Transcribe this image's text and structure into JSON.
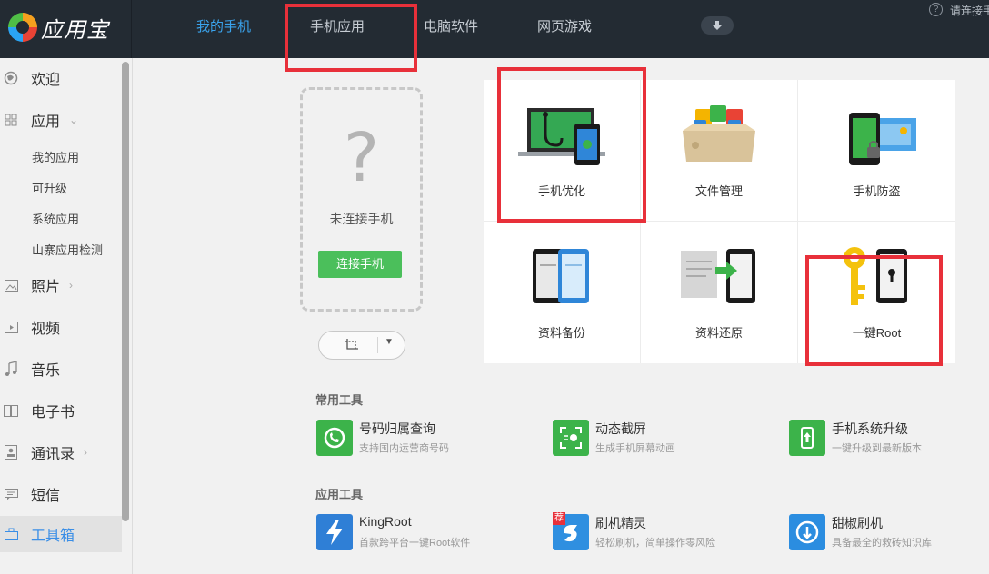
{
  "app": {
    "name": "应用宝"
  },
  "nav": {
    "tabs": [
      {
        "label": "我的手机",
        "active": true
      },
      {
        "label": "手机应用",
        "active": false
      },
      {
        "label": "电脑软件",
        "active": false
      },
      {
        "label": "网页游戏",
        "active": false
      }
    ],
    "help_label": "请连接手",
    "help_icon": "?"
  },
  "sidebar": {
    "items": [
      {
        "label": "欢迎",
        "icon": "globe-icon"
      },
      {
        "label": "应用",
        "icon": "grid-icon",
        "arrow": "⌄"
      },
      {
        "label": "照片",
        "icon": "image-icon",
        "arrow": "›"
      },
      {
        "label": "视频",
        "icon": "video-icon"
      },
      {
        "label": "音乐",
        "icon": "music-icon"
      },
      {
        "label": "电子书",
        "icon": "book-icon"
      },
      {
        "label": "通讯录",
        "icon": "contacts-icon",
        "arrow": "›"
      },
      {
        "label": "短信",
        "icon": "message-icon"
      },
      {
        "label": "工具箱",
        "icon": "toolbox-icon",
        "active": true
      }
    ],
    "sub_items": [
      "我的应用",
      "可升级",
      "系统应用",
      "山寨应用检测"
    ]
  },
  "phone_panel": {
    "status_symbol": "?",
    "status_text": "未连接手机",
    "connect_label": "连接手机"
  },
  "features": [
    {
      "label": "手机优化",
      "icon": "laptop-stethoscope-icon"
    },
    {
      "label": "文件管理",
      "icon": "file-box-icon"
    },
    {
      "label": "手机防盗",
      "icon": "phone-lock-icon"
    },
    {
      "label": "资料备份",
      "icon": "backup-phones-icon"
    },
    {
      "label": "资料还原",
      "icon": "restore-arrow-icon"
    },
    {
      "label": "一键Root",
      "icon": "key-phone-icon"
    }
  ],
  "common_tools": {
    "title": "常用工具",
    "items": [
      {
        "name": "号码归属查询",
        "desc": "支持国内运营商号码",
        "icon": "phone-search-icon",
        "color": "#3cb34a"
      },
      {
        "name": "动态截屏",
        "desc": "生成手机屏幕动画",
        "icon": "screen-capture-icon",
        "color": "#3cb34a"
      },
      {
        "name": "手机系统升级",
        "desc": "一键升级到最新版本",
        "icon": "phone-upgrade-icon",
        "color": "#3cb34a"
      }
    ]
  },
  "app_tools": {
    "title": "应用工具",
    "items": [
      {
        "name": "KingRoot",
        "desc": "首款跨平台一键Root软件",
        "icon": "lightning-icon",
        "color": "#2f7fd6"
      },
      {
        "name": "刷机精灵",
        "desc": "轻松刷机，简单操作零风险",
        "icon": "flash-sprite-icon",
        "color": "#2f8fe0",
        "badge": "荐"
      },
      {
        "name": "甜椒刷机",
        "desc": "具备最全的救砖知识库",
        "icon": "pepper-flash-icon",
        "color": "#2b8de0"
      }
    ]
  },
  "colors": {
    "accent": "#3aa3ec",
    "highlight": "#e8303a",
    "connect": "#4bbf5b"
  }
}
